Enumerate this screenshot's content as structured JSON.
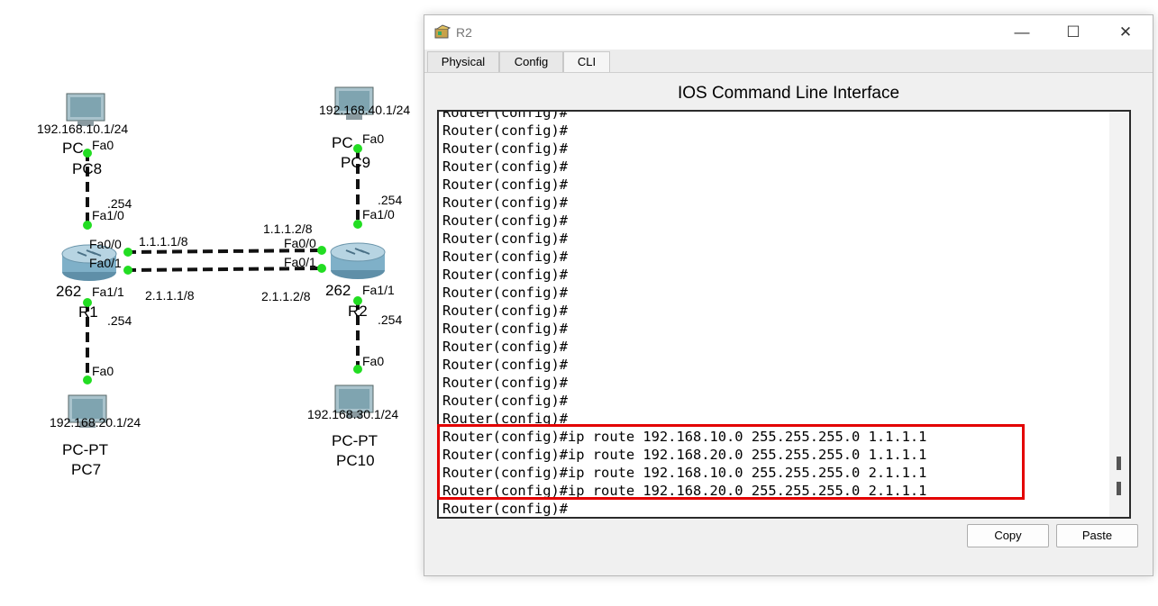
{
  "topology": {
    "pcs": [
      {
        "name": "PC8",
        "type_label": "PC",
        "ip": "192.168.10.1/24",
        "port": "Fa0"
      },
      {
        "name": "PC9",
        "type_label": "PC",
        "ip": "192.168.40.1/24",
        "port": "Fa0"
      },
      {
        "name": "PC7",
        "type_label": "PC-PT",
        "ip": "192.168.20.1/24",
        "port": "Fa0"
      },
      {
        "name": "PC10",
        "type_label": "PC-PT",
        "ip": "192.168.30.1/24",
        "port": "Fa0"
      }
    ],
    "routers": [
      {
        "name": "R1",
        "model": "262",
        "ports": [
          "Fa1/0",
          "Fa0/0",
          "Fa0/1",
          "Fa1/1"
        ],
        "gw_top": ".254",
        "gw_bottom": ".254",
        "ip_fa00": "1.1.1.1/8",
        "ip_fa01": "2.1.1.1/8"
      },
      {
        "name": "R2",
        "model": "262",
        "ports": [
          "Fa1/0",
          "Fa0/0",
          "Fa0/1",
          "Fa1/1"
        ],
        "gw_top": ".254",
        "gw_bottom": ".254",
        "ip_fa00": "1.1.1.2/8",
        "ip_fa01": "2.1.1.2/8"
      }
    ]
  },
  "window": {
    "title": "R2",
    "controls": {
      "minimize": "—",
      "maximize": "☐",
      "close": "✕"
    },
    "tabs": [
      "Physical",
      "Config",
      "CLI"
    ],
    "active_tab": "CLI",
    "heading": "IOS Command Line Interface",
    "console_lines": [
      "Router(config)#",
      "Router(config)#",
      "Router(config)#",
      "Router(config)#",
      "Router(config)#",
      "Router(config)#",
      "Router(config)#",
      "Router(config)#",
      "Router(config)#",
      "Router(config)#",
      "Router(config)#",
      "Router(config)#",
      "Router(config)#",
      "Router(config)#",
      "Router(config)#",
      "Router(config)#",
      "Router(config)#",
      "Router(config)#",
      "Router(config)#ip route 192.168.10.0 255.255.255.0 1.1.1.1",
      "Router(config)#ip route 192.168.20.0 255.255.255.0 1.1.1.1",
      "Router(config)#ip route 192.168.10.0 255.255.255.0 2.1.1.1",
      "Router(config)#ip route 192.168.20.0 255.255.255.0 2.1.1.1",
      "Router(config)#"
    ],
    "buttons": {
      "copy": "Copy",
      "paste": "Paste"
    }
  },
  "colors": {
    "highlight": "#e30000",
    "link_dot": "#22cc22"
  }
}
